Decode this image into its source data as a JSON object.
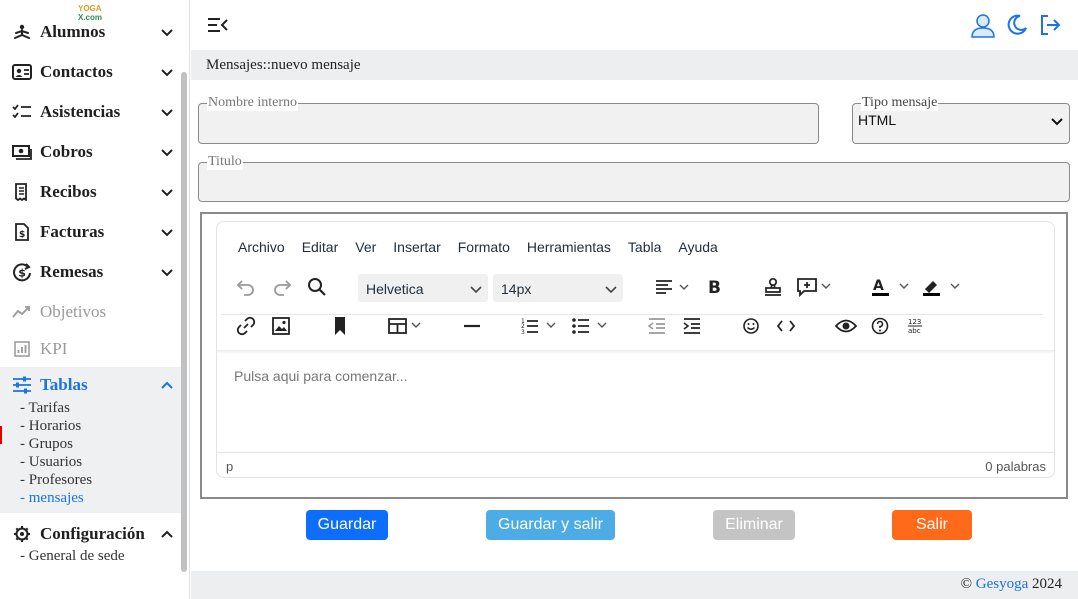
{
  "logo": {
    "line1": "YOGA",
    "line2": "X.com"
  },
  "sidebar": {
    "items": [
      {
        "label": "Alumnos",
        "icon": "meditation-icon"
      },
      {
        "label": "Contactos",
        "icon": "contact-card-icon"
      },
      {
        "label": "Asistencias",
        "icon": "checklist-icon"
      },
      {
        "label": "Cobros",
        "icon": "cash-icon"
      },
      {
        "label": "Recibos",
        "icon": "receipt-icon"
      },
      {
        "label": "Facturas",
        "icon": "invoice-icon"
      },
      {
        "label": "Remesas",
        "icon": "dollar-cycle-icon"
      },
      {
        "label": "Objetivos",
        "icon": "trend-icon"
      },
      {
        "label": "KPI",
        "icon": "kpi-chart-icon"
      },
      {
        "label": "Tablas",
        "icon": "sliders-icon"
      },
      {
        "label": "Configuración",
        "icon": "gear-icon"
      }
    ],
    "tablas_sub": [
      "- Tarifas",
      "- Horarios",
      "- Grupos",
      "- Usuarios",
      "- Profesores",
      "- mensajes"
    ],
    "config_sub": [
      "- General de sede"
    ],
    "active_color": "#1a73e8"
  },
  "breadcrumb": "Mensajes::nuevo mensaje",
  "form": {
    "nombre_interno_label": "Nombre interno",
    "tipo_mensaje_label": "Tipo mensaje",
    "tipo_mensaje_value": "HTML",
    "titulo_label": "Titulo"
  },
  "editor": {
    "menu": [
      "Archivo",
      "Editar",
      "Ver",
      "Insertar",
      "Formato",
      "Herramientas",
      "Tabla",
      "Ayuda"
    ],
    "font_family": "Helvetica",
    "font_size": "14px",
    "placeholder": "Pulsa aqui para comenzar...",
    "status_path": "p",
    "word_count": "0 palabras"
  },
  "buttons": {
    "guardar": "Guardar",
    "guardar_salir": "Guardar y salir",
    "eliminar": "Eliminar",
    "salir": "Salir",
    "colors": {
      "guardar": "#0d6efd",
      "guardar_salir": "#4dabe6",
      "eliminar": "#c4c4c4",
      "salir": "#ff6a1a"
    }
  },
  "footer": {
    "copyright": "©",
    "brand": "Gesyoga",
    "year": "2024"
  }
}
